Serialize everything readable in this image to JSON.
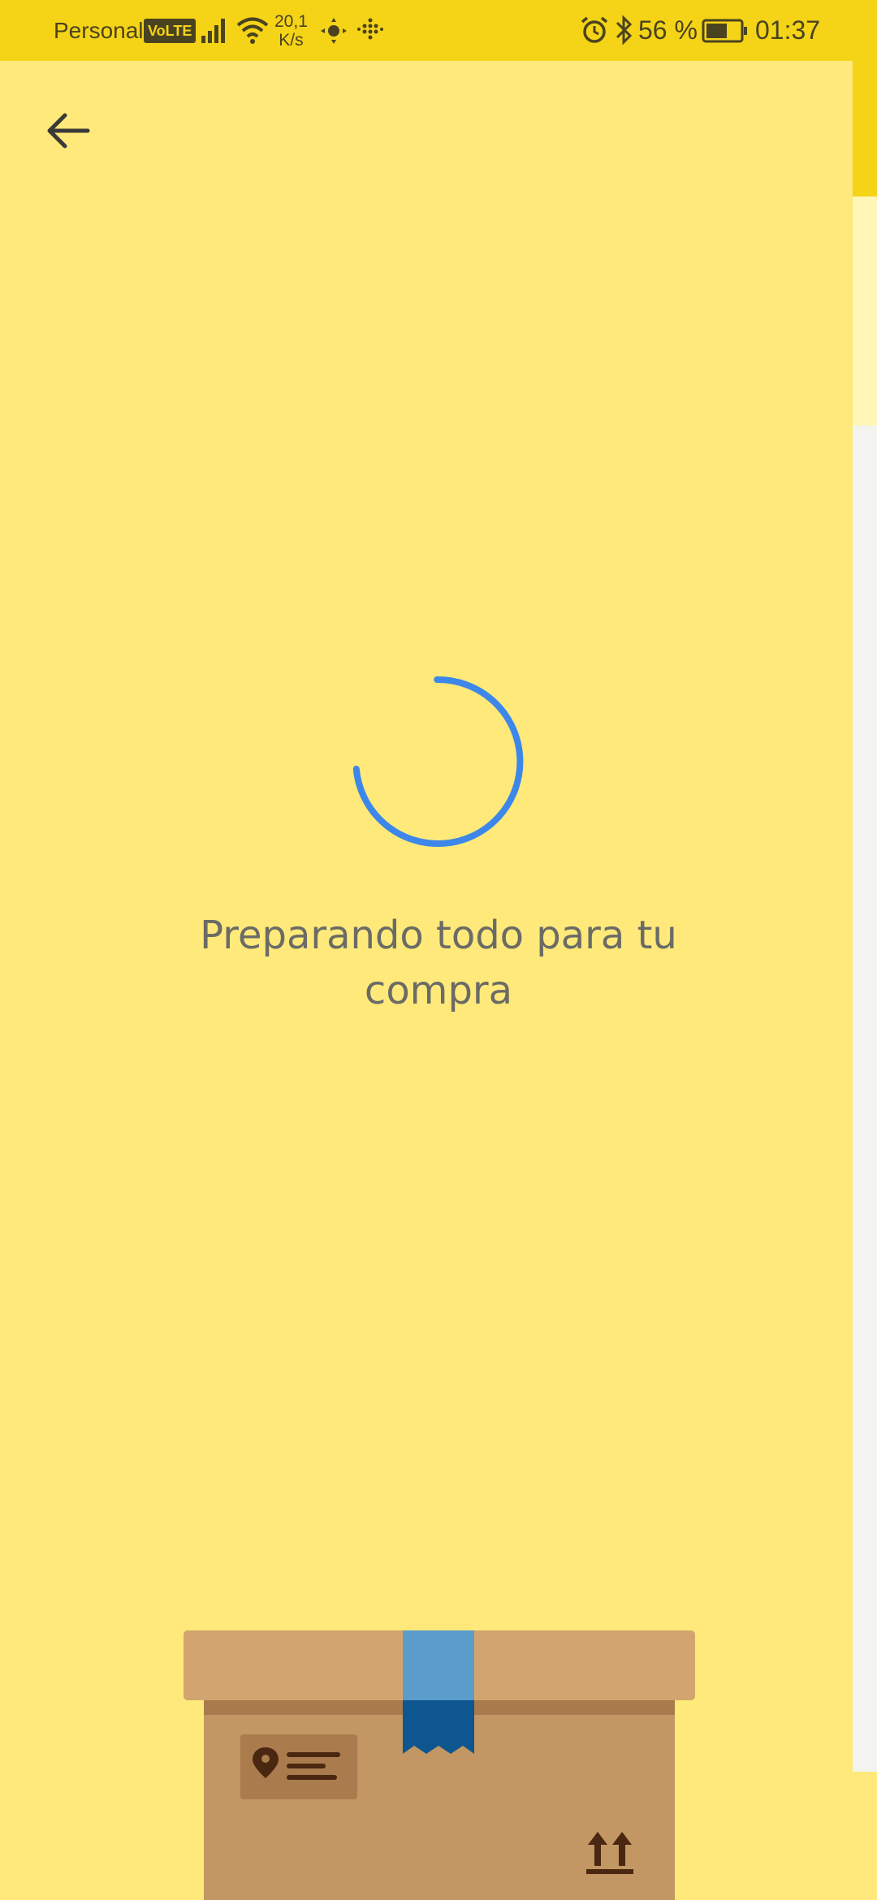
{
  "status_bar": {
    "carrier": "Personal",
    "volte_badge": "VoLTE",
    "net_speed_value": "20,1",
    "net_speed_unit": "K/s",
    "battery_percent": "56 %",
    "time": "01:37",
    "icons": [
      "signal-icon",
      "wifi-icon",
      "location-icon",
      "app-notification-icon",
      "alarm-icon",
      "bluetooth-icon",
      "battery-icon"
    ]
  },
  "navigation": {
    "back_icon": "arrow-left-icon"
  },
  "loading": {
    "message_line1": "Preparando todo para tu",
    "message_line2": "compra",
    "spinner_color": "#3d87ea"
  },
  "illustration": {
    "name": "package-box",
    "icons": [
      "location-pin-icon",
      "this-side-up-icon"
    ]
  },
  "colors": {
    "status_bar_bg": "#f5d316",
    "page_bg": "#fee97a",
    "accent_blue": "#3d87ea"
  }
}
